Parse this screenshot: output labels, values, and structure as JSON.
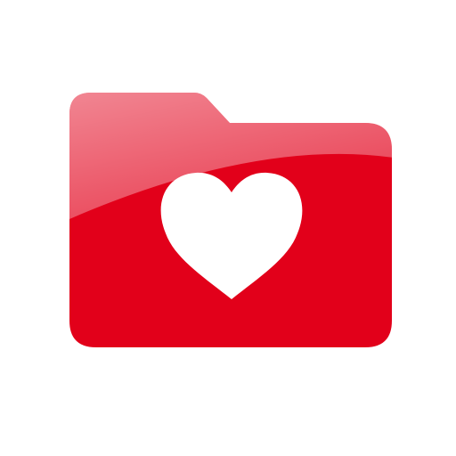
{
  "icon": {
    "name": "folder-heart-icon",
    "background": "#ffffff",
    "folder_color": "#e2001a",
    "folder_highlight": "#f2b3b8",
    "heart_color": "#ffffff"
  }
}
